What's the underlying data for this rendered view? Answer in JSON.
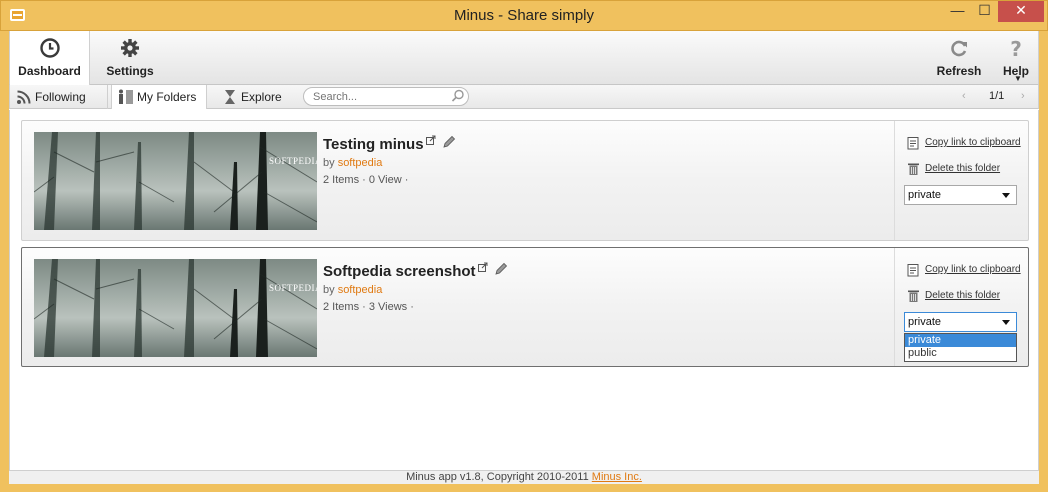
{
  "window": {
    "title": "Minus - Share simply",
    "minimize": "—",
    "maximize": "☐",
    "close": "✕"
  },
  "toolbar": {
    "dashboard_label": "Dashboard",
    "settings_label": "Settings",
    "refresh_label": "Refresh",
    "help_label": "Help"
  },
  "subnav": {
    "following_label": "Following",
    "myfolders_label": "My Folders",
    "explore_label": "Explore",
    "search_placeholder": "Search...",
    "pager_prev": "‹",
    "pager_text": "1/1",
    "pager_next": "›"
  },
  "folders": [
    {
      "title": "Testing minus",
      "by": "by",
      "owner": "softpedia",
      "items": "2 Items",
      "views": "0 View",
      "watermark": "SOFTPEDIA",
      "copy_link": "Copy link to clipboard",
      "delete": "Delete this folder",
      "privacy": "private",
      "selected": false
    },
    {
      "title": "Softpedia screenshot",
      "by": "by",
      "owner": "softpedia",
      "items": "2 Items",
      "views": "3 Views",
      "watermark": "SOFTPEDIA",
      "copy_link": "Copy link to clipboard",
      "delete": "Delete this folder",
      "privacy": "private",
      "privacy_options": [
        "private",
        "public"
      ],
      "selected": true
    }
  ],
  "footer": {
    "text": "Minus app v1.8, Copyright 2010-2011",
    "link": "Minus Inc."
  },
  "colors": {
    "frame": "#f0c15e",
    "link_orange": "#e07a12",
    "select_blue": "#3b8ad8"
  }
}
